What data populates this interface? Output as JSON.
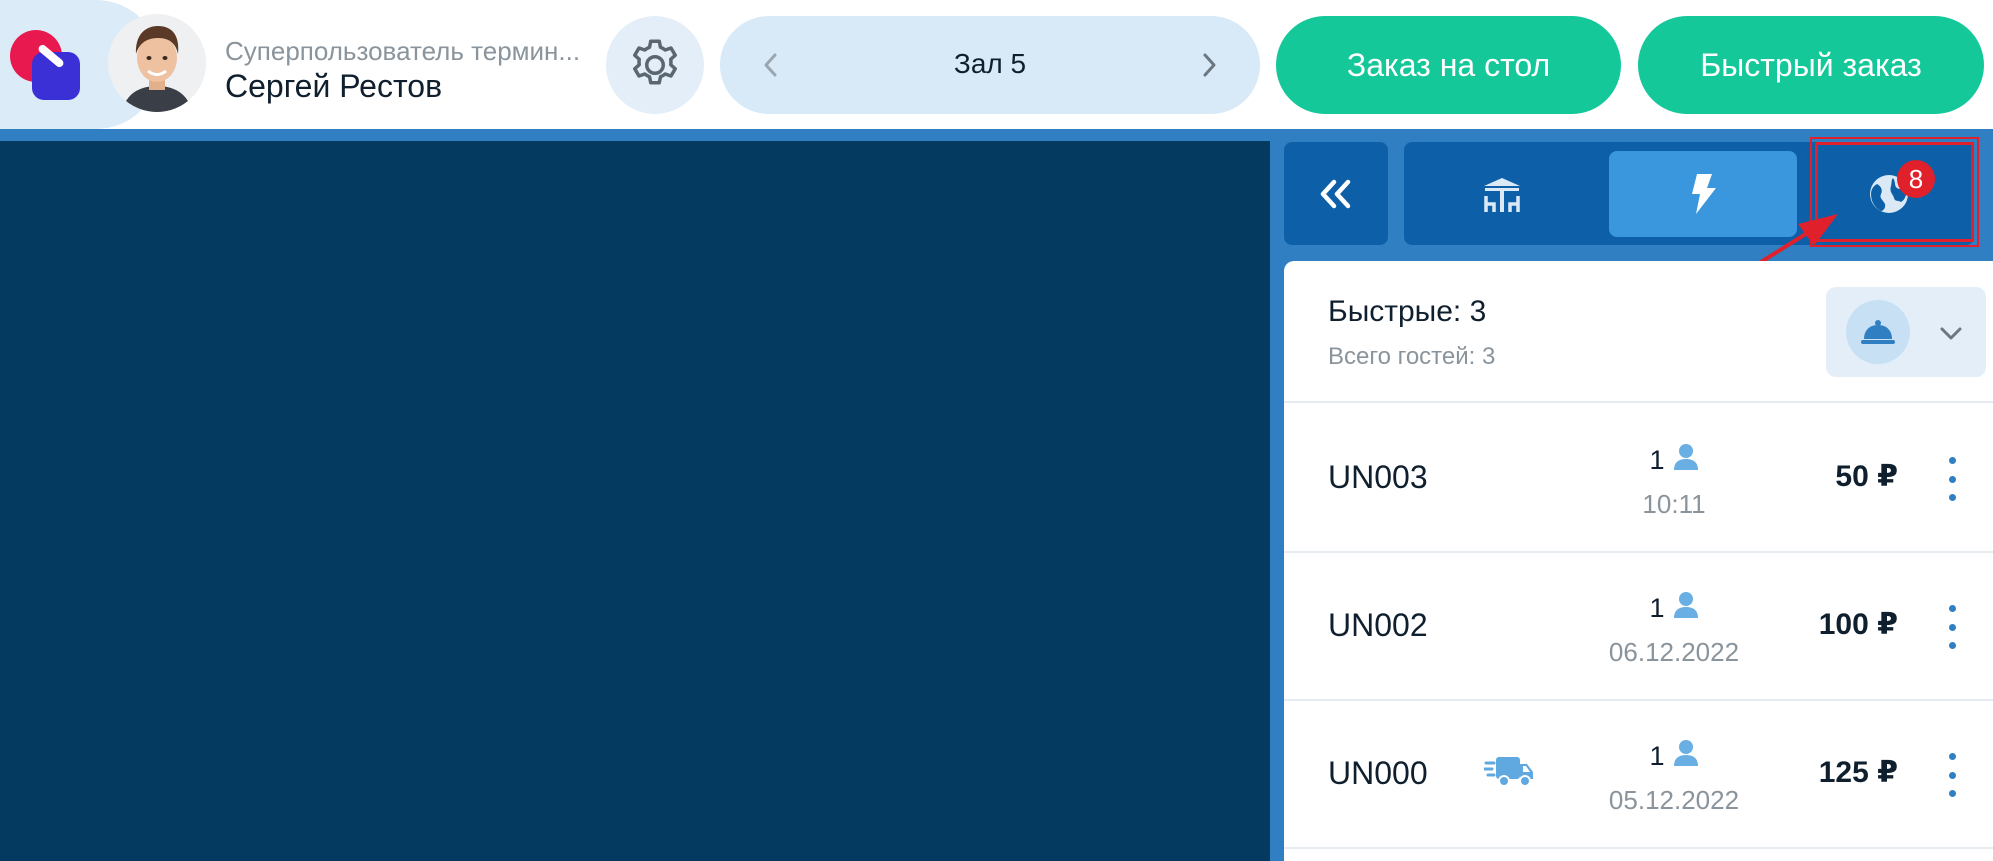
{
  "header": {
    "user_role": "Суперпользователь термин...",
    "user_name": "Сергей Рестов",
    "hall": {
      "name": "Зал 5"
    },
    "table_order_label": "Заказ на стол",
    "quick_order_label": "Быстрый заказ"
  },
  "tabs": [
    {
      "icon": "tables-icon",
      "active": false
    },
    {
      "icon": "lightning-icon",
      "active": true
    },
    {
      "icon": "globe-icon",
      "active": false,
      "badge": "8"
    }
  ],
  "summary": {
    "title": "Быстрые: 3",
    "guests": "Всего гостей: 3"
  },
  "orders": [
    {
      "id": "UN003",
      "guests": "1",
      "time": "10:11",
      "sum": "50 ₽",
      "delivery": false
    },
    {
      "id": "UN002",
      "guests": "1",
      "time": "06.12.2022",
      "sum": "100 ₽",
      "delivery": false
    },
    {
      "id": "UN000",
      "guests": "1",
      "time": "05.12.2022",
      "sum": "125 ₽",
      "delivery": true
    }
  ],
  "colors": {
    "accent_green": "#14c89a",
    "panel_blue": "#0d60a8",
    "map_bg": "#053a60",
    "badge_red": "#e0202a"
  }
}
